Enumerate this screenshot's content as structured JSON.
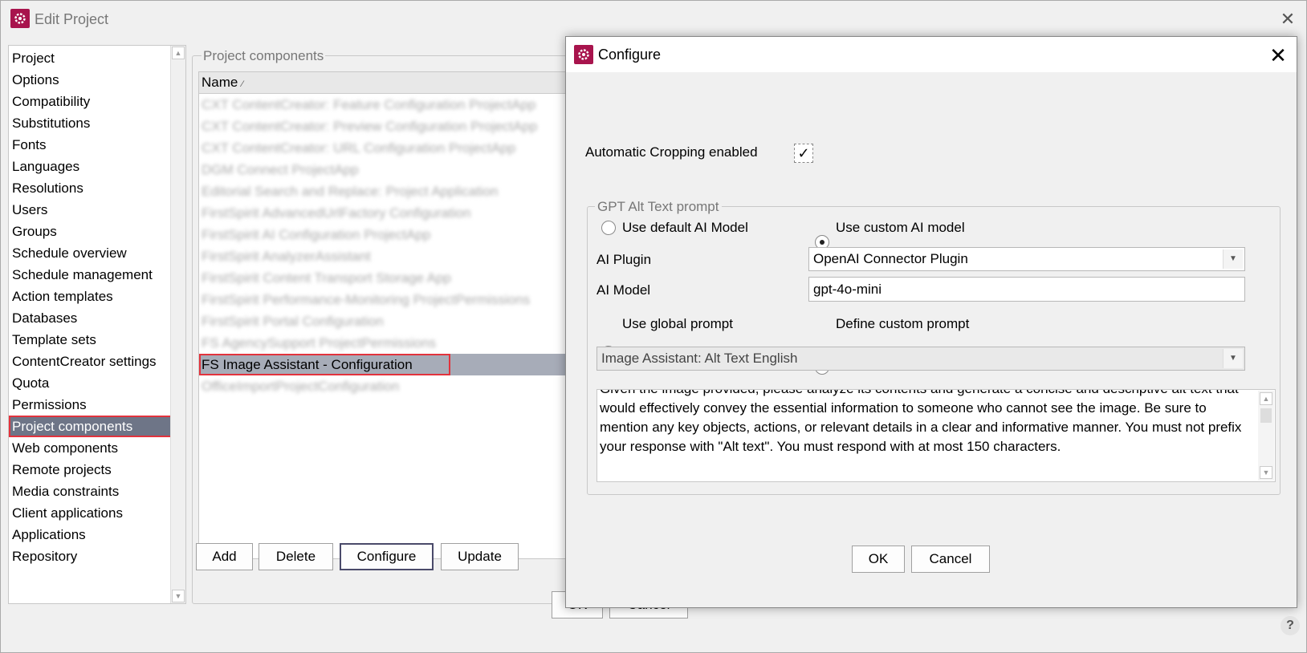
{
  "main_window": {
    "title": "Edit Project",
    "close_symbol": "✕",
    "help_symbol": "?",
    "ok_label": "OK",
    "cancel_label": "Cancel"
  },
  "nav": {
    "items": [
      "Project",
      "Options",
      "Compatibility",
      "Substitutions",
      "Fonts",
      "Languages",
      "Resolutions",
      "Users",
      "Groups",
      "Schedule overview",
      "Schedule management",
      "Action templates",
      "Databases",
      "Template sets",
      "ContentCreator settings",
      "Quota",
      "Permissions",
      "Project components",
      "Web components",
      "Remote projects",
      "Media constraints",
      "Client applications",
      "Applications",
      "Repository"
    ],
    "selected": "Project components"
  },
  "components": {
    "legend": "Project components",
    "column_header": "Name",
    "sort_symbol": "⁄",
    "rows": [
      "CXT ContentCreator: Feature Configuration ProjectApp",
      "CXT ContentCreator: Preview Configuration ProjectApp",
      "CXT ContentCreator: URL Configuration ProjectApp",
      "DGM Connect ProjectApp",
      "Editorial Search and Replace: Project Application",
      "FirstSpirit AdvancedUrlFactory Configuration",
      "FirstSpirit AI Configuration ProjectApp",
      "FirstSpirit AnalyzerAssistant",
      "FirstSpirit Content Transport Storage App",
      "FirstSpirit Performance-Monitoring ProjectPermissions",
      "FirstSpirit Portal Configuration",
      "FS AgencySupport ProjectPermissions",
      "FS Image Assistant - Configuration",
      "OfficeImportProjectConfiguration"
    ],
    "selected_row": "FS Image Assistant - Configuration",
    "buttons": {
      "add": "Add",
      "delete": "Delete",
      "configure": "Configure",
      "update": "Update"
    }
  },
  "dialog": {
    "title": "Configure",
    "close_symbol": "✕",
    "cropping_label": "Automatic Cropping enabled",
    "cropping_check": "✓",
    "gpt_legend": "GPT Alt Text prompt",
    "radio_default_model": "Use default AI Model",
    "radio_custom_model": "Use custom AI model",
    "ai_plugin_label": "AI Plugin",
    "ai_plugin_value": "OpenAI Connector Plugin",
    "ai_model_label": "AI Model",
    "ai_model_value": "gpt-4o-mini",
    "radio_global_prompt": "Use global prompt",
    "radio_custom_prompt": "Define custom prompt",
    "prompt_select_value": "Image Assistant: Alt Text English",
    "prompt_text": "Given the image provided, please analyze its contents and generate a concise and descriptive alt text that would effectively convey the essential information to someone who cannot see the image. Be sure to mention any key objects, actions, or relevant details in a clear and informative manner. You must not prefix your response with \"Alt text\". You must respond with at most 150 characters.",
    "ok_label": "OK",
    "cancel_label": "Cancel"
  },
  "colors": {
    "brand": "#a8144d",
    "selection": "#6e7587",
    "highlight_outline": "#e2333d"
  }
}
